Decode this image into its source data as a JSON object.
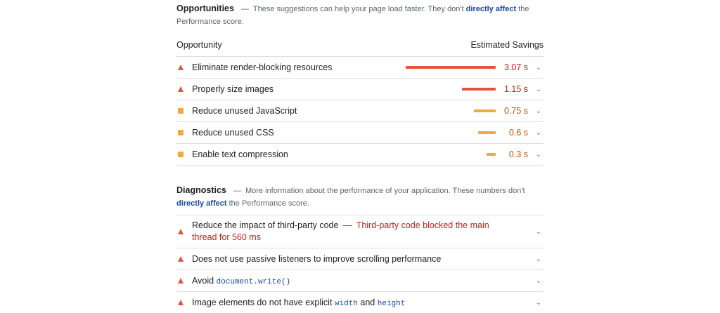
{
  "colors": {
    "red": "#e5533b",
    "orange": "#f0a841",
    "red_text": "#c5221f",
    "orange_text": "#c2550b",
    "link": "#1a47a8"
  },
  "opportunities": {
    "title": "Opportunities",
    "desc_pre": "These suggestions can help your page load faster. They don't",
    "desc_link": "directly affect",
    "desc_post": "the Performance score.",
    "col_opportunity": "Opportunity",
    "col_savings": "Estimated Savings",
    "items": [
      {
        "label": "Eliminate render-blocking resources",
        "value": "3.07 s",
        "severity": "fail",
        "savings": 3.07
      },
      {
        "label": "Properly size images",
        "value": "1.15 s",
        "severity": "fail",
        "savings": 1.15
      },
      {
        "label": "Reduce unused JavaScript",
        "value": "0.75 s",
        "severity": "average",
        "savings": 0.75
      },
      {
        "label": "Reduce unused CSS",
        "value": "0.6 s",
        "severity": "average",
        "savings": 0.6
      },
      {
        "label": "Enable text compression",
        "value": "0.3 s",
        "severity": "average",
        "savings": 0.3
      }
    ]
  },
  "diagnostics": {
    "title": "Diagnostics",
    "desc_pre": "More information about the performance of your application. These numbers don't",
    "desc_link": "directly affect",
    "desc_post": "the Performance score.",
    "item0_label": "Reduce the impact of third-party code",
    "item0_detail": "Third-party code blocked the main thread for 560 ms",
    "item1_label": "Does not use passive listeners to improve scrolling performance",
    "item2_label": "Avoid",
    "item2_code": "document.write()",
    "item3_label_pre": "Image elements do not have explicit",
    "item3_code1": "width",
    "item3_and": "and",
    "item3_code2": "height"
  }
}
